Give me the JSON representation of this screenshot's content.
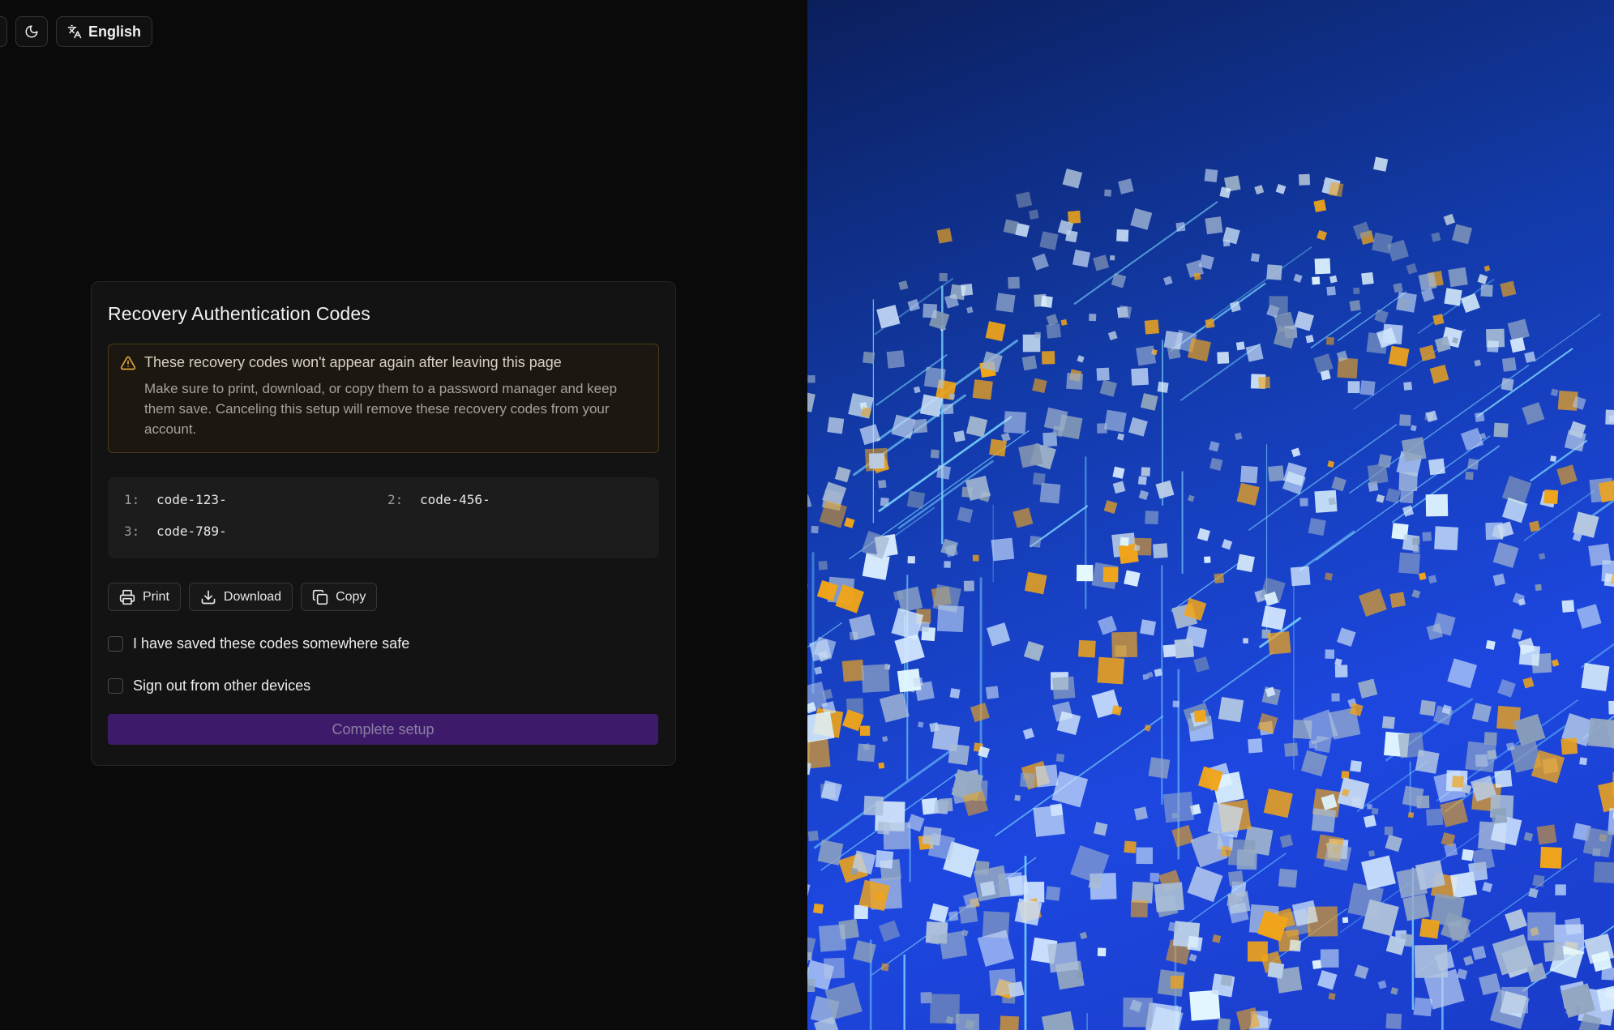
{
  "topbar": {
    "language_label": "English",
    "theme_icon": "moon-icon",
    "language_icon": "translate-icon"
  },
  "card": {
    "title": "Recovery Authentication Codes",
    "warning": {
      "title": "These recovery codes won't appear again after leaving this page",
      "body": "Make sure to print, download, or copy them to a password manager and keep them save. Canceling this setup will remove these recovery codes from your account.",
      "icon": "warning-icon",
      "color": "#e0a53a"
    },
    "codes": [
      {
        "index": "1:",
        "value": "code-123-"
      },
      {
        "index": "2:",
        "value": "code-456-"
      },
      {
        "index": "3:",
        "value": "code-789-"
      }
    ],
    "actions": [
      {
        "label": "Print",
        "icon": "printer-icon"
      },
      {
        "label": "Download",
        "icon": "download-icon"
      },
      {
        "label": "Copy",
        "icon": "copy-icon"
      }
    ],
    "checkboxes": [
      {
        "label": "I have saved these codes somewhere safe",
        "checked": false
      },
      {
        "label": "Sign out from other devices",
        "checked": false
      }
    ],
    "submit_label": "Complete setup",
    "accent_color": "#3d1a6a"
  }
}
